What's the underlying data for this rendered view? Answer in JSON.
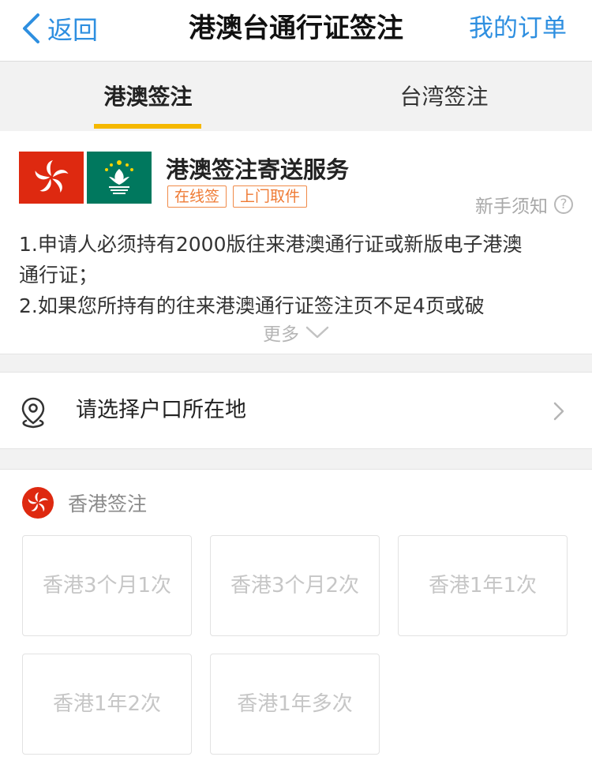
{
  "nav": {
    "back_label": "返回",
    "title": "港澳台通行证签注",
    "orders_label": "我的订单"
  },
  "tabs": [
    {
      "label": "港澳签注",
      "active": true
    },
    {
      "label": "台湾签注",
      "active": false
    }
  ],
  "service": {
    "title": "港澳签注寄送服务",
    "tags": [
      "在线签",
      "上门取件"
    ],
    "guide_label": "新手须知",
    "notice_lines": [
      "1.申请人必须持有2000版往来港澳通行证或新版电子港澳",
      "通行证；",
      "2.如果您所持有的往来港澳通行证签注页不足4页或破"
    ],
    "more_label": "更多"
  },
  "location": {
    "label": "请选择户口所在地",
    "icon": "location-pin-icon"
  },
  "visa": {
    "section_title": "香港签注",
    "options": [
      "香港3个月1次",
      "香港3个月2次",
      "香港1年1次",
      "香港1年2次",
      "香港1年多次"
    ]
  },
  "colors": {
    "accent_blue": "#2e8fe0",
    "tab_indicator": "#f5b800",
    "tag_orange": "#ef7a33",
    "hk_red": "#de2910",
    "macau_green": "#00785e"
  }
}
